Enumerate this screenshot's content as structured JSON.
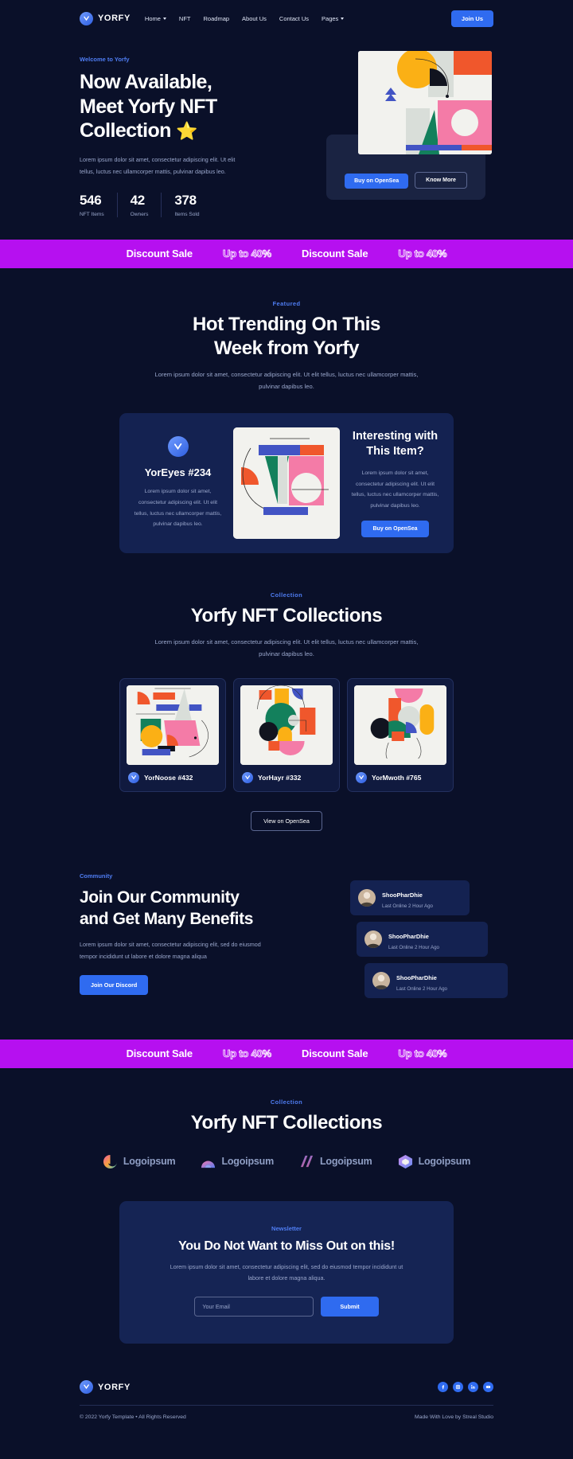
{
  "brand": {
    "name": "YORFY",
    "icon": "yorfy-logo-icon"
  },
  "nav": {
    "links": [
      {
        "label": "Home",
        "has_caret": true
      },
      {
        "label": "NFT",
        "has_caret": false
      },
      {
        "label": "Roadmap",
        "has_caret": false
      },
      {
        "label": "About Us",
        "has_caret": false
      },
      {
        "label": "Contact Us",
        "has_caret": false
      },
      {
        "label": "Pages",
        "has_caret": true
      }
    ],
    "cta": "Join Us"
  },
  "hero": {
    "eyebrow": "Welcome to Yorfy",
    "title_line1": "Now Available,",
    "title_line2": "Meet Yorfy NFT",
    "title_line3": "Collection",
    "star": "⭐",
    "paragraph": "Lorem ipsum dolor sit amet, consectetur adipiscing elit. Ut elit tellus, luctus nec ullamcorper mattis, pulvinar dapibus leo.",
    "stats": [
      {
        "value": "546",
        "label": "NFT Items"
      },
      {
        "value": "42",
        "label": "Owners"
      },
      {
        "value": "378",
        "label": "Items Sold"
      }
    ],
    "buy_button": "Buy on OpenSea",
    "know_button": "Know More"
  },
  "band": {
    "items": [
      "Discount Sale",
      "Up to 40%",
      "Discount Sale",
      "Up to 40%"
    ],
    "color": "#b610f0"
  },
  "featured": {
    "eyebrow": "Featured",
    "title_line1": "Hot Trending On This",
    "title_line2": "Week from Yorfy",
    "subtitle": "Lorem ipsum dolor sit amet, consectetur adipiscing elit. Ut elit tellus, luctus nec ullamcorper mattis, pulvinar dapibus leo.",
    "item_name": "YorEyes #234",
    "item_text": "Lorem ipsum dolor sit amet, consectetur adipiscing elit. Ut elit tellus, luctus nec ullamcorper mattis, pulvinar dapibus leo.",
    "right_title": "Interesting with This Item?",
    "right_text": "Lorem ipsum dolor sit amet, consectetur adipiscing elit. Ut elit tellus, luctus nec ullamcorper mattis, pulvinar dapibus leo.",
    "right_button": "Buy on OpenSea"
  },
  "collections": {
    "eyebrow": "Collection",
    "title": "Yorfy NFT Collections",
    "subtitle": "Lorem ipsum dolor sit amet, consectetur adipiscing elit. Ut elit tellus, luctus nec ullamcorper mattis, pulvinar dapibus leo.",
    "cards": [
      {
        "name": "YorNoose #432"
      },
      {
        "name": "YorHayr #332"
      },
      {
        "name": "YorMwoth #765"
      }
    ],
    "view_button": "View on OpenSea"
  },
  "community": {
    "eyebrow": "Community",
    "title_line1": "Join Our Community",
    "title_line2": "and Get Many Benefits",
    "paragraph": "Lorem ipsum dolor sit amet, consectetur adipiscing elit, sed do eiusmod tempor incididunt ut labore et dolore magna aliqua",
    "button": "Join Our Discord",
    "members": [
      {
        "name": "ShooPharDhie",
        "status": "Last Online 2 Hour Ago"
      },
      {
        "name": "ShooPharDhie",
        "status": "Last Online 2 Hour Ago"
      },
      {
        "name": "ShooPharDhie",
        "status": "Last Online 2 Hour Ago"
      }
    ]
  },
  "partners": {
    "eyebrow": "Collection",
    "title": "Yorfy NFT Collections",
    "logos": [
      {
        "label": "Logoipsum",
        "mark": "logoipsum-swirl-icon"
      },
      {
        "label": "Logoipsum",
        "mark": "logoipsum-arch-icon"
      },
      {
        "label": "Logoipsum",
        "mark": "logoipsum-stripes-icon"
      },
      {
        "label": "Logoipsum",
        "mark": "logoipsum-cube-icon"
      }
    ]
  },
  "newsletter": {
    "eyebrow": "Newsletter",
    "title": "You Do Not Want to Miss Out on this!",
    "paragraph": "Lorem ipsum dolor sit amet, consectetur adipiscing elit, sed do eiusmod tempor incididunt ut labore et dolore magna aliqua.",
    "input_placeholder": "Your Email",
    "input_value": "",
    "submit": "Submit"
  },
  "footer": {
    "brand": "YORFY",
    "socials": [
      "facebook-icon",
      "instagram-icon",
      "linkedin-icon",
      "youtube-icon"
    ],
    "copyright": "© 2022 Yorfy Template • All Rights Reserved",
    "made_by": "Made With Love by Streal Studio"
  }
}
